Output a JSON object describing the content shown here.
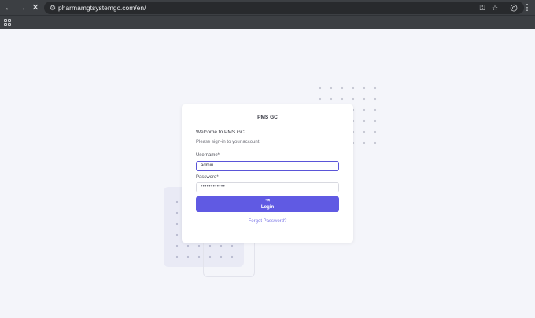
{
  "browser": {
    "url": "pharmamgtsystemgc.com/en/",
    "back_icon": "←",
    "forward_icon": "→",
    "stop_icon": "✕",
    "tune_icon": "⚙",
    "key_icon": "⚿",
    "star_icon": "☆",
    "profile_icon": "◎",
    "menu_icon": "⋮"
  },
  "login": {
    "title": "PMS GC",
    "welcome": "Welcome to PMS GC!",
    "subtitle": "Please sign-in to your account.",
    "username_label": "Username*",
    "username_value": "admin",
    "password_label": "Password*",
    "password_value": "••••••••••••",
    "login_icon": "⇥",
    "login_label": "Login",
    "forgot_label": "Forgot Password?"
  },
  "colors": {
    "primary": "#605ae3",
    "link": "#7a75e6",
    "background": "#f4f5fa"
  }
}
